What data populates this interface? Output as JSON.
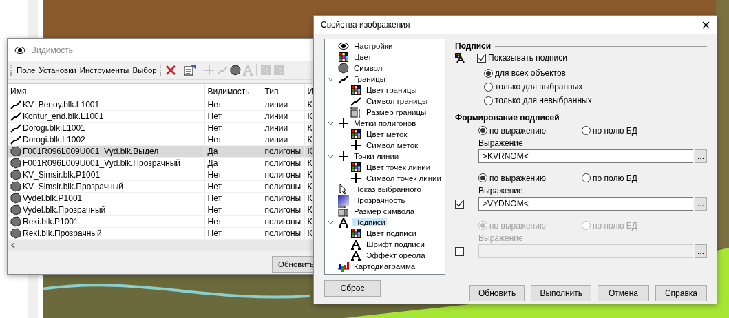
{
  "visibility_window": {
    "title": "Видимость",
    "menu": [
      "Поле",
      "Установки",
      "Инструменты",
      "Выбор"
    ],
    "toolbar": [
      {
        "kind": "delete",
        "disabled": false
      },
      {
        "kind": "properties",
        "disabled": false
      },
      {
        "kind": "plus",
        "disabled": true
      },
      {
        "kind": "line",
        "disabled": true
      },
      {
        "kind": "polygon",
        "disabled": false
      },
      {
        "kind": "font",
        "disabled": true
      },
      {
        "kind": "grid",
        "disabled": true
      },
      {
        "kind": "grid",
        "disabled": true
      }
    ],
    "table": {
      "columns": [
        "Имя",
        "Видимость",
        "Тип",
        "И"
      ],
      "rows": [
        {
          "kind": "line",
          "name": "KV_Benoy.blk.L1001",
          "visibility": "Нет",
          "type": "линии",
          "column_4": "К",
          "selected": false
        },
        {
          "kind": "line",
          "name": "Kontur_end.blk.L1001",
          "visibility": "Нет",
          "type": "линии",
          "column_4": "К",
          "selected": false
        },
        {
          "kind": "line",
          "name": "Dorogi.blk.L1001",
          "visibility": "Нет",
          "type": "линии",
          "column_4": "К",
          "selected": false
        },
        {
          "kind": "line",
          "name": "Dorogi.blk.L1002",
          "visibility": "Нет",
          "type": "линии",
          "column_4": "К",
          "selected": false
        },
        {
          "kind": "polygon",
          "name": "F001R096L009U001_Vyd.blk.Выдел",
          "visibility": "Да",
          "type": "полигоны",
          "column_4": "К",
          "selected": true
        },
        {
          "kind": "polygon",
          "name": "F001R096L009U001_Vyd.blk.Прозрачный",
          "visibility": "Да",
          "type": "полигоны",
          "column_4": "К",
          "selected": false
        },
        {
          "kind": "polygon",
          "name": "KV_Simsir.blk.P1001",
          "visibility": "Нет",
          "type": "полигоны",
          "column_4": "К",
          "selected": false
        },
        {
          "kind": "polygon",
          "name": "KV_Simsir.blk.Прозрачный",
          "visibility": "Нет",
          "type": "полигоны",
          "column_4": "К",
          "selected": false
        },
        {
          "kind": "polygon",
          "name": "Vydel.blk.P1001",
          "visibility": "Нет",
          "type": "полигоны",
          "column_4": "К",
          "selected": false
        },
        {
          "kind": "polygon",
          "name": "Vydel.blk.Прозрачный",
          "visibility": "Нет",
          "type": "полигоны",
          "column_4": "К",
          "selected": false
        },
        {
          "kind": "polygon",
          "name": "Reki.blk.P1001",
          "visibility": "Нет",
          "type": "полигоны",
          "column_4": "К",
          "selected": false
        },
        {
          "kind": "polygon",
          "name": "Reki.blk.Прозрачный",
          "visibility": "Нет",
          "type": "полигоны",
          "column_4": "К",
          "selected": false
        }
      ]
    },
    "buttons": [
      "Обновить"
    ]
  },
  "properties_dialog": {
    "title": "Свойства изображения",
    "tree_items": [
      {
        "kind": "eye",
        "label": "Настройки",
        "selected": false
      },
      {
        "kind": "palette",
        "label": "Цвет",
        "selected": false
      },
      {
        "kind": "polygon",
        "label": "Символ",
        "selected": false
      },
      {
        "kind": "line",
        "label": "Границы",
        "selected": false,
        "expanded": true,
        "children": [
          {
            "kind": "palette",
            "label": "Цвет границы",
            "selected": false
          },
          {
            "kind": "line",
            "label": "Символ границы",
            "selected": false
          },
          {
            "kind": "size",
            "label": "Размер границы",
            "selected": false
          }
        ]
      },
      {
        "kind": "plus",
        "label": "Метки полигонов",
        "selected": false,
        "expanded": true,
        "children": [
          {
            "kind": "palette",
            "label": "Цвет меток",
            "selected": false
          },
          {
            "kind": "plus",
            "label": "Символ меток",
            "selected": false
          }
        ]
      },
      {
        "kind": "plus",
        "label": "Точки линии",
        "selected": false,
        "expanded": true,
        "children": [
          {
            "kind": "palette",
            "label": "Цвет точек линии",
            "selected": false
          },
          {
            "kind": "plus",
            "label": "Символ точек линии",
            "selected": false
          }
        ]
      },
      {
        "kind": "cursor",
        "label": "Показ выбранного",
        "selected": false
      },
      {
        "kind": "gradient",
        "label": "Прозрачность",
        "selected": false
      },
      {
        "kind": "size",
        "label": "Размер символа",
        "selected": false
      },
      {
        "kind": "font",
        "label": "Подписи",
        "selected": true,
        "expanded": true,
        "children": [
          {
            "kind": "palette",
            "label": "Цвет подписи",
            "selected": false
          },
          {
            "kind": "font",
            "label": "Шрифт подписи",
            "selected": false
          },
          {
            "kind": "font",
            "label": "Эффект ореола",
            "selected": false
          }
        ]
      },
      {
        "kind": "chart",
        "label": "Картодиаграмма",
        "selected": false
      }
    ],
    "labels_section": {
      "title": "Подписи",
      "show_labels": {
        "label": "Показывать подписи",
        "checked": true
      },
      "scope_options": [
        {
          "label": "для всех объектов",
          "selected": true
        },
        {
          "label": "только для выбранных",
          "selected": false
        },
        {
          "label": "только для невыбранных",
          "selected": false
        }
      ]
    },
    "forming_section": {
      "title": "Формирование подписей",
      "expressions": [
        {
          "disabled": false,
          "options": [
            {
              "label": "по выражению",
              "selected": true
            },
            {
              "label": "по полю БД",
              "selected": false
            }
          ],
          "field_label": "Выражение",
          "value": ">KVRNOM<",
          "browse_button": "..."
        },
        {
          "checked": true,
          "disabled": false,
          "options": [
            {
              "label": "по выражению",
              "selected": true
            },
            {
              "label": "по полю БД",
              "selected": false
            }
          ],
          "field_label": "Выражение",
          "value": ">VYDNOM<",
          "browse_button": "..."
        },
        {
          "checked": false,
          "disabled": true,
          "options": [
            {
              "label": "по выражению",
              "selected": true
            },
            {
              "label": "по полю БД",
              "selected": false
            }
          ],
          "field_label": "Выражение",
          "browse_button": "..."
        }
      ]
    },
    "reset_button": "Сброс",
    "buttons": [
      "Обновить",
      "Выполнить",
      "Отмена",
      "Справка"
    ]
  }
}
